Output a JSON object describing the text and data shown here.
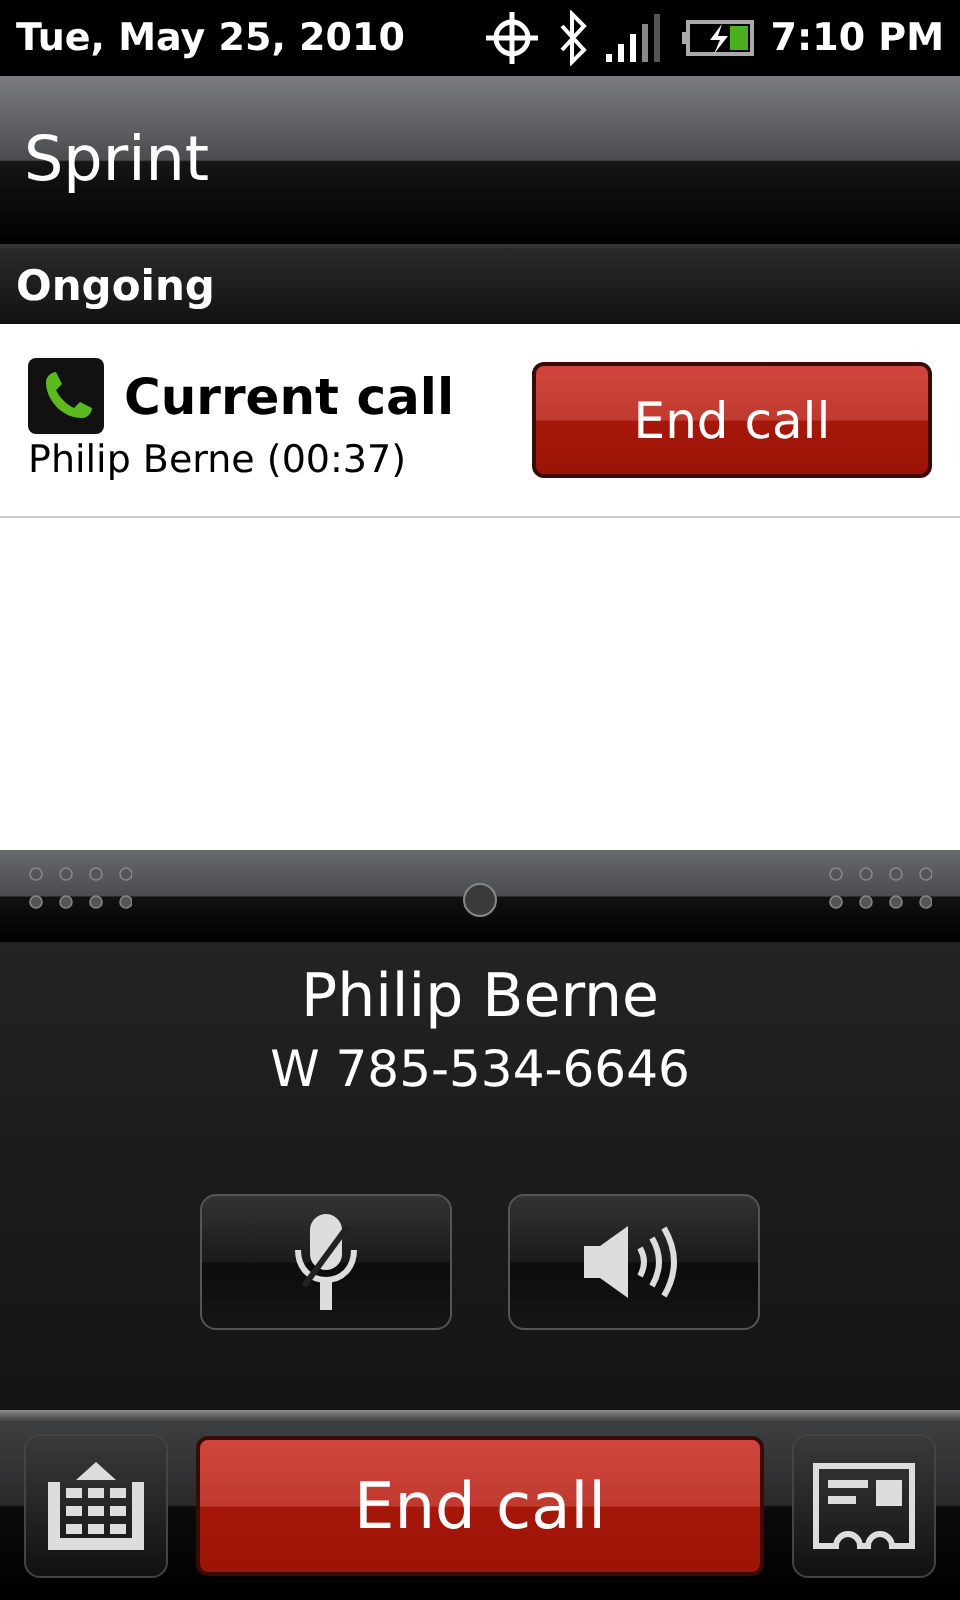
{
  "status_bar": {
    "date": "Tue, May 25, 2010",
    "time": "7:10 PM"
  },
  "title": "Sprint",
  "section": "Ongoing",
  "notification": {
    "title": "Current call",
    "detail": "Philip Berne (00:37)",
    "button": "End call"
  },
  "caller": {
    "name": "Philip Berne",
    "number": "W 785-534-6646"
  },
  "bottom_bar": {
    "button": "End call"
  }
}
